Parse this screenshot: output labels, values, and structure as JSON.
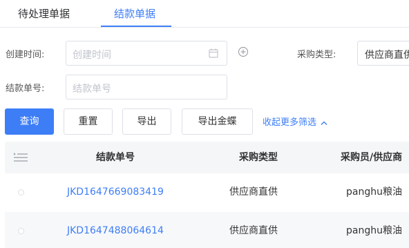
{
  "tabs": [
    {
      "label": "待处理单据",
      "active": false
    },
    {
      "label": "结款单据",
      "active": true
    }
  ],
  "filters": {
    "created_time_label": "创建时间:",
    "created_time_placeholder": "创建时间",
    "purchase_type_label": "采购类型:",
    "purchase_type_value": "供应商直供",
    "settlement_no_label": "结款单号:",
    "settlement_no_placeholder": "结款单号"
  },
  "actions": {
    "query": "查询",
    "reset": "重置",
    "export": "导出",
    "export_kingdee": "导出金蝶",
    "collapse": "收起更多筛选"
  },
  "table": {
    "headers": {
      "settlement_no": "结款单号",
      "purchase_type": "采购类型",
      "buyer_supplier": "采购员/供应商"
    },
    "rows": [
      {
        "settlement_no": "JKD1647669083419",
        "purchase_type": "供应商直供",
        "buyer_supplier": "panghu粮油"
      },
      {
        "settlement_no": "JKD1647488064614",
        "purchase_type": "供应商直供",
        "buyer_supplier": "panghu粮油"
      }
    ]
  },
  "colors": {
    "accent": "#3d7ef7",
    "border": "#dcdfe6",
    "header_bg": "#f5f6f8"
  }
}
